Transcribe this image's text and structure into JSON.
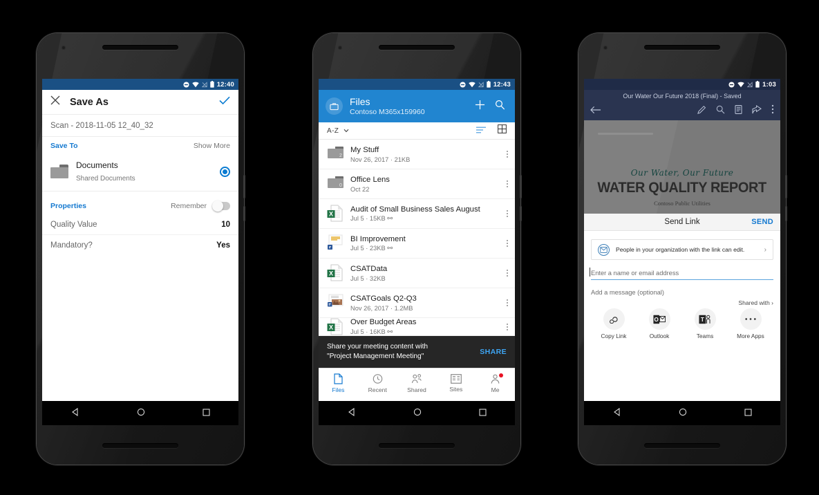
{
  "phones": [
    {
      "id": "save-as",
      "status_bar": {
        "time": "12:40",
        "icons": [
          "dnd-icon",
          "wifi-icon",
          "signal-off-icon",
          "battery-icon"
        ]
      },
      "header": {
        "close_label": "✕",
        "title": "Save As",
        "confirm_label": "✓"
      },
      "filename": "Scan - 2018-11-05 12_40_32",
      "save_to": {
        "label": "Save To",
        "action": "Show More"
      },
      "destination": {
        "name": "Documents",
        "subtitle": "Shared Documents",
        "selected": true
      },
      "properties": {
        "label": "Properties",
        "remember_label": "Remember",
        "remember_on": false,
        "rows": [
          {
            "label": "Quality Value",
            "value": "10"
          },
          {
            "label": "Mandatory?",
            "value": "Yes"
          }
        ]
      }
    },
    {
      "id": "files",
      "status_bar": {
        "time": "12:43",
        "icons": [
          "dnd-icon",
          "wifi-icon",
          "signal-off-icon",
          "battery-icon"
        ]
      },
      "header": {
        "title": "Files",
        "subtitle": "Contoso M365x159960",
        "add_label": "+",
        "search_label": "search-icon"
      },
      "sortbar": {
        "sort": "A-Z",
        "list_view": "list-view-icon",
        "grid_view": "grid-view-icon"
      },
      "files": [
        {
          "name": "My Stuff",
          "meta": "Nov 26, 2017 · 21KB",
          "kind": "folder",
          "count": "2"
        },
        {
          "name": "Office Lens",
          "meta": "Oct 22",
          "kind": "folder",
          "count": "0"
        },
        {
          "name": "Audit of Small Business Sales August",
          "meta": "Jul 5 · 15KB",
          "kind": "excel",
          "shared": true
        },
        {
          "name": "BI Improvement",
          "meta": "Jul 5 · 23KB",
          "kind": "powerpoint",
          "shared": true
        },
        {
          "name": "CSATData",
          "meta": "Jul 5 · 32KB",
          "kind": "excel",
          "shared": false
        },
        {
          "name": "CSATGoals Q2-Q3",
          "meta": "Nov 26, 2017 · 1.2MB",
          "kind": "powerpoint-photo",
          "shared": false
        },
        {
          "name": "Over Budget Areas",
          "meta": "Jul 5 · 16KB",
          "kind": "excel",
          "shared": true
        }
      ],
      "banner": {
        "text": "Share your meeting content with \"Project Management Meeting\"",
        "action": "SHARE"
      },
      "tabs": [
        {
          "label": "Files",
          "icon": "document-icon",
          "active": true
        },
        {
          "label": "Recent",
          "icon": "clock-icon",
          "active": false
        },
        {
          "label": "Shared",
          "icon": "people-icon",
          "active": false
        },
        {
          "label": "Sites",
          "icon": "sites-icon",
          "active": false
        },
        {
          "label": "Me",
          "icon": "person-icon",
          "active": false,
          "badge": true
        }
      ]
    },
    {
      "id": "send-link",
      "status_bar": {
        "time": "1:03",
        "icons": [
          "dnd-icon",
          "wifi-icon",
          "signal-off-icon",
          "battery-icon"
        ]
      },
      "doc": {
        "titlebar": "Our Water Our Future 2018 (Final) - Saved",
        "toolbar_icons": [
          "back-arrow-icon",
          "edit-pencil-icon",
          "search-icon",
          "mobile-view-icon",
          "share-icon",
          "overflow-menu-icon"
        ],
        "script_line": "Our Water, Our Future",
        "heading": "WATER QUALITY REPORT",
        "subheading": "Contoso Public Utilities"
      },
      "send_link": {
        "title": "Send Link",
        "send_label": "SEND",
        "permission": "People in your organization with the link can edit.",
        "recipient_placeholder": "Enter a name or email address",
        "message_placeholder": "Add a message (optional)",
        "shared_with": "Shared with",
        "apps": [
          {
            "label": "Copy Link",
            "icon": "link-icon"
          },
          {
            "label": "Outlook",
            "icon": "outlook-icon"
          },
          {
            "label": "Teams",
            "icon": "teams-icon"
          },
          {
            "label": "More Apps",
            "icon": "ellipsis-icon"
          }
        ]
      }
    }
  ],
  "android_nav": {
    "back": "back-triangle-icon",
    "home": "home-circle-icon",
    "recents": "recents-square-icon"
  },
  "colors": {
    "accent_blue": "#1479d0",
    "header_blue": "#2185d0",
    "status_blue": "#1a5084",
    "word_navy": "#2a3450",
    "excel_green": "#217346",
    "badge_red": "#e81123"
  }
}
